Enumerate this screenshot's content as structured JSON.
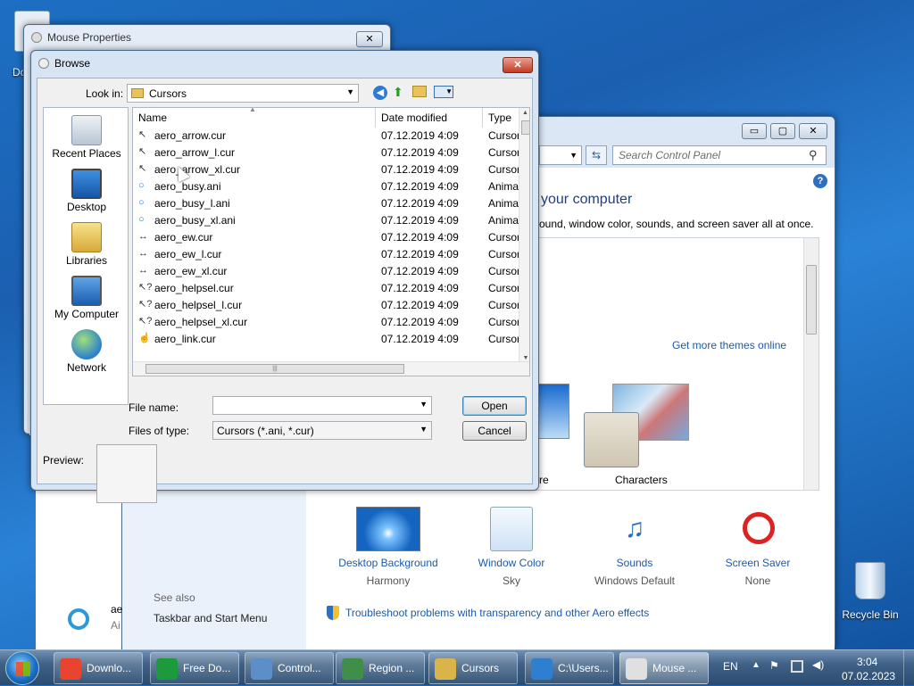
{
  "desktop": {
    "partial_icon_label": "Do",
    "recycle_bin": "Recycle Bin"
  },
  "mouse_properties": {
    "title": "Mouse Properties",
    "close": "✕"
  },
  "control_panel": {
    "search_placeholder": "Search Control Panel",
    "heading": "your computer",
    "subheading": "ound, window color, sounds, and screen saver all at once.",
    "get_more": "Get more themes online",
    "themes": [
      {
        "label": "re"
      },
      {
        "label": "Characters"
      }
    ],
    "see_also": "See also",
    "taskbar_link": "Taskbar and Start Menu",
    "partial_side_a": "ae",
    "partial_side_b": "Ai",
    "bottom_items": [
      {
        "label": "Desktop Background",
        "value": "Harmony"
      },
      {
        "label": "Window Color",
        "value": "Sky"
      },
      {
        "label": "Sounds",
        "value": "Windows Default"
      },
      {
        "label": "Screen Saver",
        "value": "None"
      }
    ],
    "troubleshoot": "Troubleshoot problems with transparency and other Aero effects",
    "min": "▭",
    "max": "▢",
    "close": "✕"
  },
  "browse": {
    "title": "Browse",
    "close": "✕",
    "look_in_label": "Look in:",
    "look_in_value": "Cursors",
    "places": [
      "Recent Places",
      "Desktop",
      "Libraries",
      "My Computer",
      "Network"
    ],
    "columns": [
      "Name",
      "Date modified",
      "Type"
    ],
    "files": [
      {
        "name": "aero_arrow.cur",
        "date": "07.12.2019 4:09",
        "type": "Cursor",
        "icon": "arrow-cursor-icon"
      },
      {
        "name": "aero_arrow_l.cur",
        "date": "07.12.2019 4:09",
        "type": "Cursor",
        "icon": "arrow-cursor-icon"
      },
      {
        "name": "aero_arrow_xl.cur",
        "date": "07.12.2019 4:09",
        "type": "Cursor",
        "icon": "arrow-cursor-icon"
      },
      {
        "name": "aero_busy.ani",
        "date": "07.12.2019 4:09",
        "type": "Anima",
        "icon": "busy-cursor-icon"
      },
      {
        "name": "aero_busy_l.ani",
        "date": "07.12.2019 4:09",
        "type": "Anima",
        "icon": "busy-cursor-icon"
      },
      {
        "name": "aero_busy_xl.ani",
        "date": "07.12.2019 4:09",
        "type": "Anima",
        "icon": "busy-cursor-icon"
      },
      {
        "name": "aero_ew.cur",
        "date": "07.12.2019 4:09",
        "type": "Cursor",
        "icon": "resize-cursor-icon"
      },
      {
        "name": "aero_ew_l.cur",
        "date": "07.12.2019 4:09",
        "type": "Cursor",
        "icon": "resize-cursor-icon"
      },
      {
        "name": "aero_ew_xl.cur",
        "date": "07.12.2019 4:09",
        "type": "Cursor",
        "icon": "resize-cursor-icon"
      },
      {
        "name": "aero_helpsel.cur",
        "date": "07.12.2019 4:09",
        "type": "Cursor",
        "icon": "help-cursor-icon"
      },
      {
        "name": "aero_helpsel_l.cur",
        "date": "07.12.2019 4:09",
        "type": "Cursor",
        "icon": "help-cursor-icon"
      },
      {
        "name": "aero_helpsel_xl.cur",
        "date": "07.12.2019 4:09",
        "type": "Cursor",
        "icon": "help-cursor-icon"
      },
      {
        "name": "aero_link.cur",
        "date": "07.12.2019 4:09",
        "type": "Cursor",
        "icon": "link-cursor-icon"
      }
    ],
    "file_name_label": "File name:",
    "file_name_value": "",
    "file_type_label": "Files of type:",
    "file_type_value": "Cursors (*.ani, *.cur)",
    "open": "Open",
    "cancel": "Cancel",
    "preview_label": "Preview:"
  },
  "taskbar": {
    "items": [
      "Downlo...",
      "Free Do...",
      "Control...",
      "Region ...",
      "Cursors",
      "C:\\Users...",
      "Mouse ..."
    ],
    "lang": "EN",
    "time": "3:04",
    "date": "07.02.2023"
  },
  "colors": {
    "link": "#1e5aa8",
    "selection": "#cce8ff"
  }
}
